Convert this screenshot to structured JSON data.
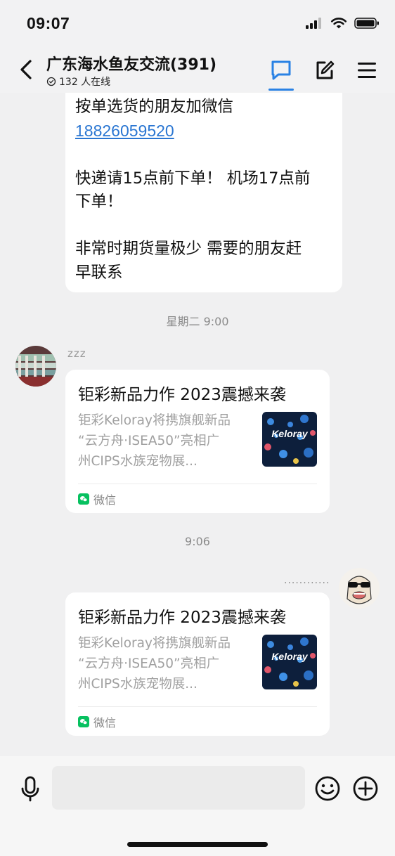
{
  "status_bar": {
    "time": "09:07"
  },
  "header": {
    "title": "广东海水鱼友交流(391)",
    "online": "132 人在线"
  },
  "messages": {
    "notice_lines": [
      "按单选货的朋友加微信",
      "18826059520",
      "快递请15点前下单！ 机场17点前",
      "下单！",
      "非常时期货量极少 需要的朋友赶",
      "早联系"
    ],
    "timestamp_1": "星期二 9:00",
    "sender_name": "zzz",
    "timestamp_2": "9:06",
    "my_name": "............"
  },
  "cards": [
    {
      "title": "钜彩新品力作 2023震撼来袭",
      "desc_lines": [
        "钜彩Keloray将携旗舰新品",
        "“云方舟·ISEA50”亮相广",
        "州CIPS水族宠物展..."
      ],
      "thumb_text": "Keloray",
      "source": "微信"
    },
    {
      "title": "钜彩新品力作 2023震撼来袭",
      "desc_lines": [
        "钜彩Keloray将携旗舰新品",
        "“云方舟·ISEA50”亮相广",
        "州CIPS水族宠物展..."
      ],
      "thumb_text": "Keloray",
      "source": "微信"
    }
  ],
  "colors": {
    "accent": "#2a82e4",
    "wechat_green": "#07c160",
    "link": "#2a76d2"
  }
}
